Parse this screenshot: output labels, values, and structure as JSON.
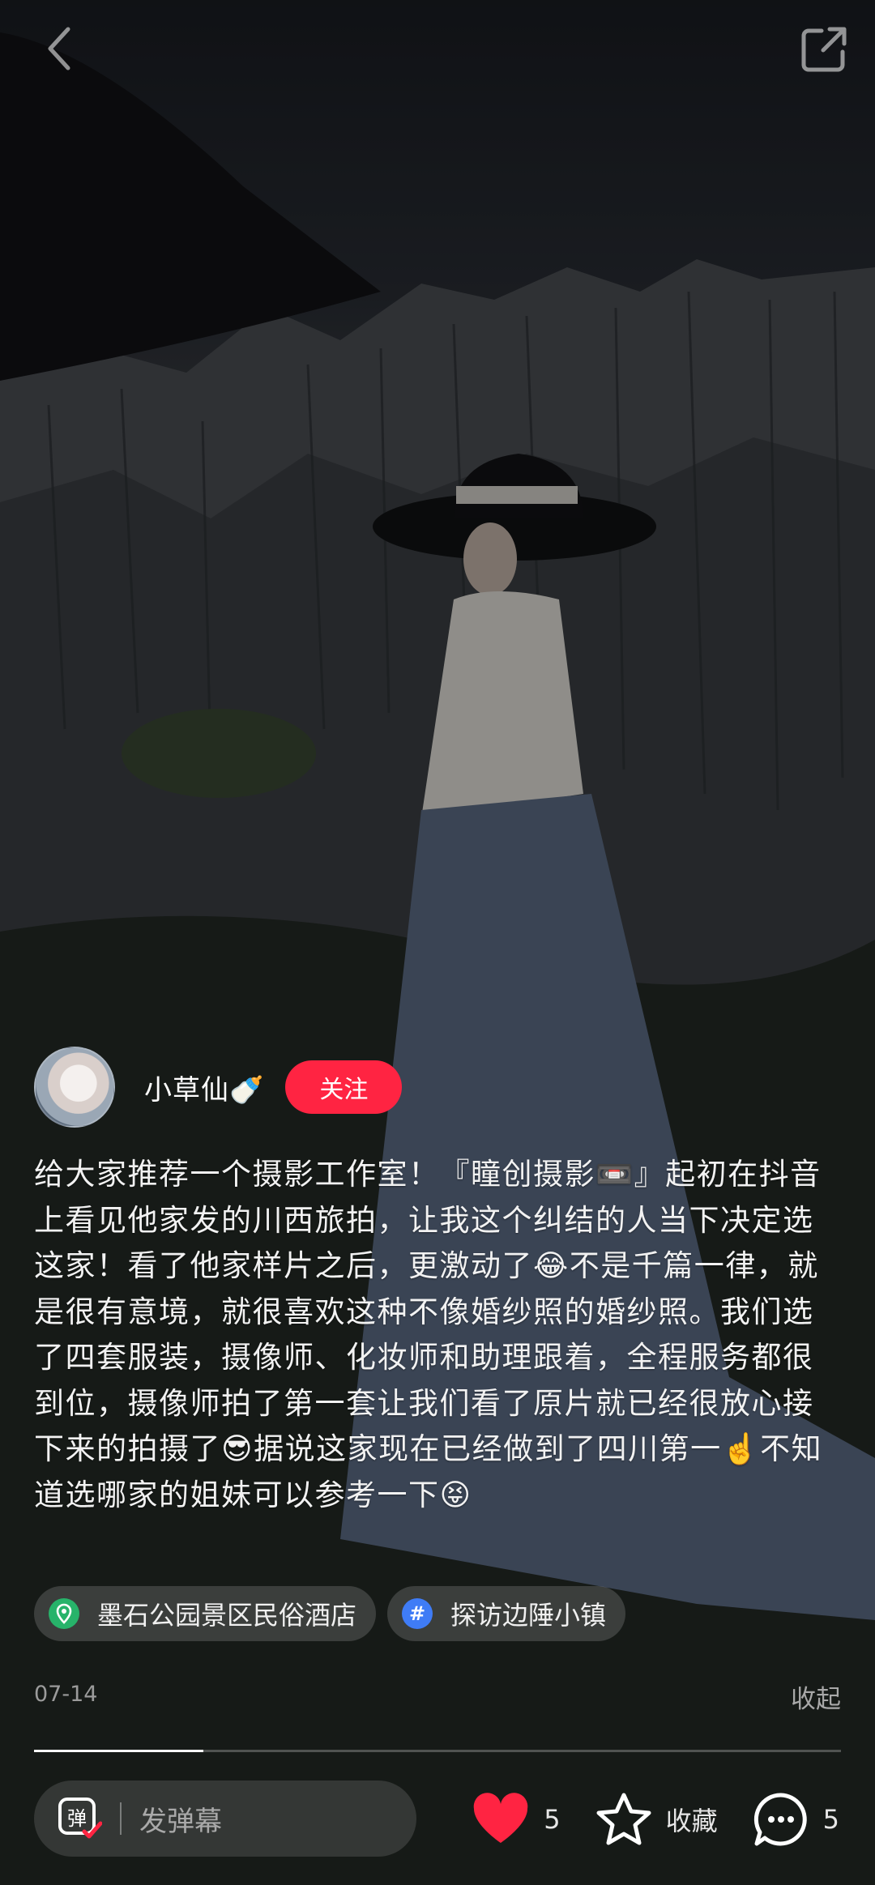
{
  "author": {
    "name": "小草仙🍼",
    "follow_label": "关注"
  },
  "post": {
    "description": "给大家推荐一个摄影工作室！『瞳创摄影📼』起初在抖音上看见他家发的川西旅拍，让我这个纠结的人当下决定选这家！看了他家样片之后，更激动了😂不是千篇一律，就是很有意境，就很喜欢这种不像婚纱照的婚纱照。我们选了四套服装，摄像师、化妆师和助理跟着，全程服务都很到位，摄像师拍了第一套让我们看了原片就已经很放心接下来的拍摄了😎据说这家现在已经做到了四川第一☝️不知道选哪家的姐妹可以参考一下😝",
    "tags": [
      {
        "type": "location",
        "icon": "location-pin-icon",
        "label": "墨石公园景区民俗酒店"
      },
      {
        "type": "topic",
        "icon": "hashtag-icon",
        "label": "探访边陲小镇"
      }
    ],
    "date": "07-14",
    "collapse_label": "收起"
  },
  "progress": {
    "fraction": 0.21
  },
  "bottom_bar": {
    "danmu_placeholder": "发弹幕",
    "danmu_icon_char": "弹",
    "likes_count": "5",
    "favorite_label": "收藏",
    "comments_count": "5"
  },
  "colors": {
    "accent": "#ff2442",
    "like": "#ff2442",
    "location_icon": "#27b36a",
    "topic_icon": "#3f7cf6"
  }
}
